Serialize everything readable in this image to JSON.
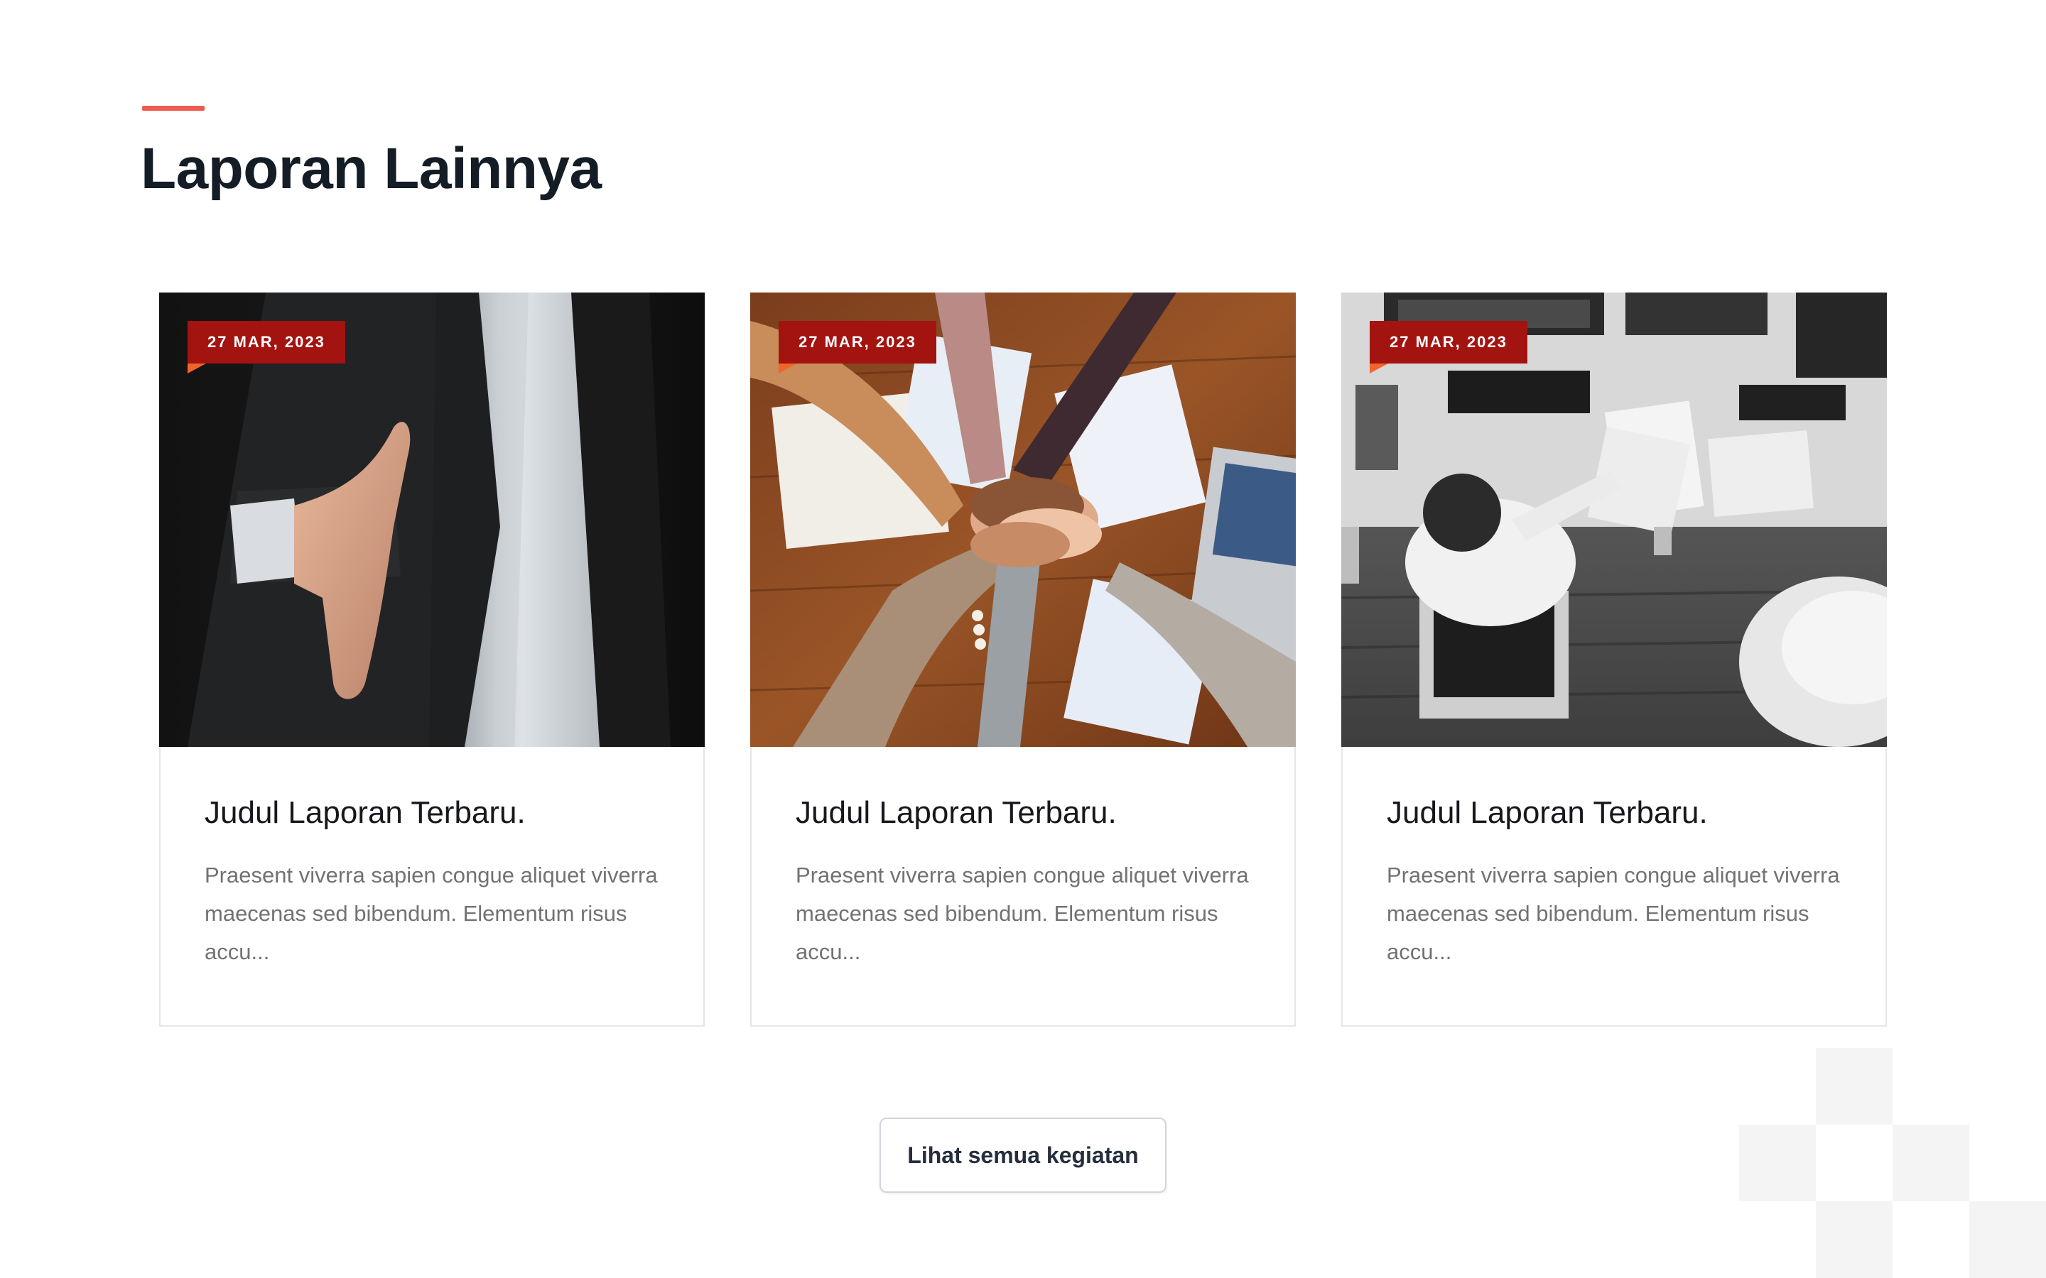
{
  "section": {
    "title": "Laporan Lainnya",
    "accent_color": "#ef5a50"
  },
  "badge_color": "#a3130f",
  "cards": [
    {
      "date": "27 MAR, 2023",
      "title": "Judul Laporan Terbaru.",
      "excerpt": "Praesent viverra sapien congue aliquet viverra maecenas sed bibendum. Elementum risus accu...",
      "image": "handshake-businessman-photo"
    },
    {
      "date": "27 MAR, 2023",
      "title": "Judul Laporan Terbaru.",
      "excerpt": "Praesent viverra sapien congue aliquet viverra maecenas sed bibendum. Elementum risus accu...",
      "image": "team-hands-stack-photo"
    },
    {
      "date": "27 MAR, 2023",
      "title": "Judul Laporan Terbaru.",
      "excerpt": "Praesent viverra sapien congue aliquet viverra maecenas sed bibendum. Elementum risus accu...",
      "image": "office-desk-overhead-bw-photo"
    }
  ],
  "view_all_button": {
    "label": "Lihat semua kegiatan"
  }
}
